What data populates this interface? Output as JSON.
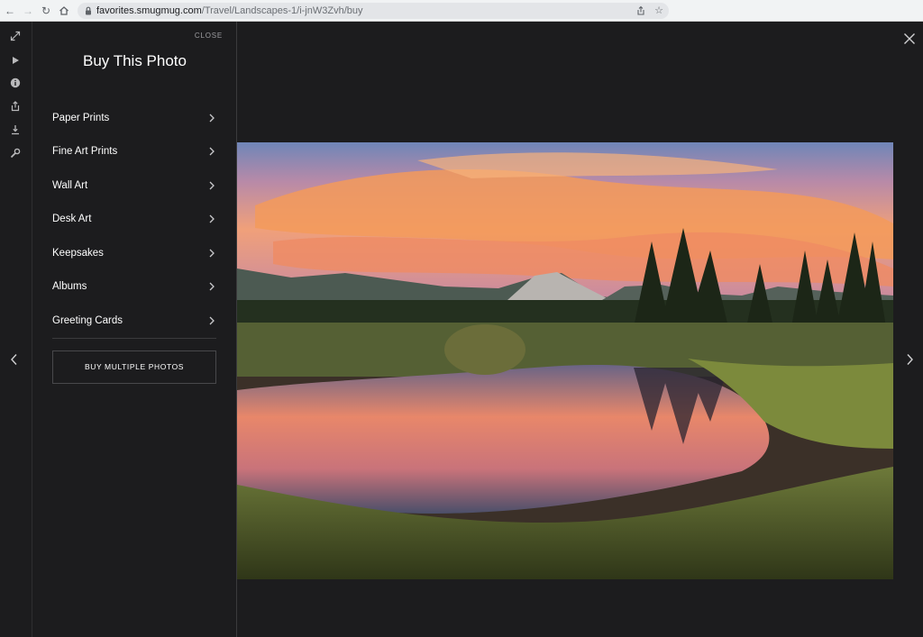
{
  "browser": {
    "url_host": "favorites.smugmug.com",
    "url_path": "/Travel/Landscapes-1/i-jnW3Zvh/buy"
  },
  "toolbar": {
    "icons": [
      "expand-icon",
      "play-icon",
      "info-icon",
      "share-icon",
      "download-icon",
      "wrench-icon"
    ]
  },
  "panel": {
    "close_label": "CLOSE",
    "title": "Buy This Photo",
    "items": [
      {
        "label": "Paper Prints"
      },
      {
        "label": "Fine Art Prints"
      },
      {
        "label": "Wall Art"
      },
      {
        "label": "Desk Art"
      },
      {
        "label": "Keepsakes"
      },
      {
        "label": "Albums"
      },
      {
        "label": "Greeting Cards"
      }
    ],
    "buy_multiple_label": "BUY MULTIPLE PHOTOS"
  },
  "colors": {
    "background": "#1c1c1e",
    "panel_border": "#3a3a3c",
    "text": "#ffffff",
    "muted": "#9d9da1"
  }
}
